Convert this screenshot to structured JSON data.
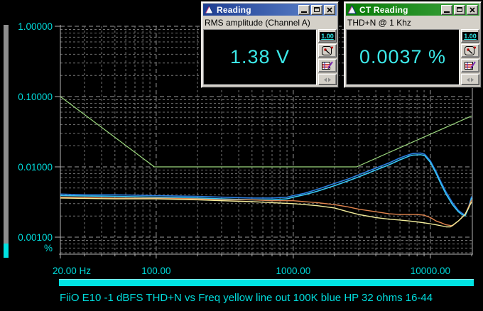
{
  "app": {
    "caption": "FiiO E10 -1 dBFS THD+N vs Freq yellow line out 100K blue HP 32 ohms 16-44"
  },
  "windows": {
    "reading": {
      "title": "Reading",
      "subtitle": "RMS amplitude (Channel A)",
      "value": "1.38 V",
      "range_button": "1.00",
      "titlebar_gradient": [
        "#1d3d92",
        "#6389cf"
      ]
    },
    "ct": {
      "title": "CT Reading",
      "subtitle": "THD+N @ 1 Khz",
      "value": "0.0037 %",
      "range_button": "1.00",
      "titlebar_gradient": [
        "#077b07",
        "#3fa33f"
      ]
    }
  },
  "colors": {
    "background": "#000000",
    "label": "#00dcdc",
    "axis": "#b2b2b2",
    "grid_major": "#9a9a9a",
    "grid_minor": "#757575",
    "scroll_track": "#8f8f8f",
    "scroll_thumb": "#00e2e2",
    "lcd_text": "#3ce9e9",
    "window_face": "#d4d0c8"
  },
  "chart_data": {
    "type": "line",
    "title": "",
    "x_axis": {
      "scale": "log",
      "min": 20,
      "max": 20000,
      "grid": true,
      "ticks": [
        {
          "value": 20,
          "label": "20.00 Hz",
          "dx": 16
        },
        {
          "value": 100,
          "label": "100.00",
          "dx": 0
        },
        {
          "value": 1000,
          "label": "1000.00",
          "dx": 0
        },
        {
          "value": 10000,
          "label": "10000.00",
          "dx": 0
        }
      ]
    },
    "y_axis": {
      "scale": "log",
      "min": 0.00056,
      "max": 1.0,
      "unit_label": "%",
      "grid": true,
      "ticks": [
        {
          "value": 1.0,
          "label": "1.00000"
        },
        {
          "value": 0.1,
          "label": "0.10000"
        },
        {
          "value": 0.01,
          "label": "0.01000"
        },
        {
          "value": 0.001,
          "label": "0.00100"
        }
      ]
    },
    "series": [
      {
        "id": "green-line-out-ref",
        "color": "#9cd87e",
        "width": 1.2,
        "points": [
          [
            20,
            0.1
          ],
          [
            97,
            0.01
          ],
          [
            2900,
            0.01
          ],
          [
            20000,
            0.053
          ]
        ]
      },
      {
        "id": "blue-hp-32ohm-a",
        "color": "#2a7de0",
        "width": 1.6,
        "points": [
          [
            20,
            0.0041
          ],
          [
            30,
            0.004
          ],
          [
            50,
            0.004
          ],
          [
            100,
            0.0039
          ],
          [
            200,
            0.0038
          ],
          [
            300,
            0.0037
          ],
          [
            500,
            0.0036
          ],
          [
            700,
            0.0036
          ],
          [
            900,
            0.0037
          ],
          [
            1000,
            0.0039
          ],
          [
            1200,
            0.0042
          ],
          [
            1500,
            0.0048
          ],
          [
            2000,
            0.0058
          ],
          [
            2500,
            0.0067
          ],
          [
            3000,
            0.0077
          ],
          [
            4000,
            0.0096
          ],
          [
            5000,
            0.0114
          ],
          [
            6000,
            0.0134
          ],
          [
            7000,
            0.015
          ],
          [
            7500,
            0.0155
          ],
          [
            8500,
            0.0157
          ],
          [
            9100,
            0.0151
          ],
          [
            10000,
            0.0122
          ],
          [
            11000,
            0.0086
          ],
          [
            12000,
            0.006
          ],
          [
            13000,
            0.0044
          ],
          [
            14500,
            0.0031
          ],
          [
            16000,
            0.0024
          ],
          [
            17000,
            0.0022
          ],
          [
            17900,
            0.00205
          ],
          [
            19000,
            0.0027
          ],
          [
            20000,
            0.0038
          ]
        ]
      },
      {
        "id": "cyan-hp-32ohm-b",
        "color": "#38c6f2",
        "width": 1.6,
        "points": [
          [
            20,
            0.0039
          ],
          [
            50,
            0.0038
          ],
          [
            100,
            0.0037
          ],
          [
            200,
            0.0036
          ],
          [
            300,
            0.0035
          ],
          [
            500,
            0.0034
          ],
          [
            700,
            0.0034
          ],
          [
            900,
            0.0035
          ],
          [
            1000,
            0.0037
          ],
          [
            1200,
            0.004
          ],
          [
            1500,
            0.0045
          ],
          [
            2000,
            0.0054
          ],
          [
            2500,
            0.0063
          ],
          [
            3000,
            0.0072
          ],
          [
            4000,
            0.009
          ],
          [
            5000,
            0.0107
          ],
          [
            6000,
            0.0126
          ],
          [
            7000,
            0.0142
          ],
          [
            7500,
            0.0147
          ],
          [
            8500,
            0.0149
          ],
          [
            9100,
            0.0144
          ],
          [
            10000,
            0.0116
          ],
          [
            11000,
            0.0081
          ],
          [
            12000,
            0.0056
          ],
          [
            13000,
            0.0041
          ],
          [
            14500,
            0.0029
          ],
          [
            16000,
            0.0023
          ],
          [
            17000,
            0.0021
          ],
          [
            17900,
            0.002
          ],
          [
            19000,
            0.0026
          ],
          [
            20000,
            0.0036
          ]
        ]
      },
      {
        "id": "orange-line-out-a",
        "color": "#e2854e",
        "width": 1.4,
        "points": [
          [
            20,
            0.0037
          ],
          [
            50,
            0.0036
          ],
          [
            100,
            0.0036
          ],
          [
            200,
            0.0035
          ],
          [
            300,
            0.0034
          ],
          [
            500,
            0.0034
          ],
          [
            700,
            0.0033
          ],
          [
            1000,
            0.0033
          ],
          [
            1500,
            0.0031
          ],
          [
            2000,
            0.0029
          ],
          [
            2500,
            0.0027
          ],
          [
            3000,
            0.0025
          ],
          [
            4000,
            0.0023
          ],
          [
            5000,
            0.00215
          ],
          [
            6000,
            0.0021
          ],
          [
            7000,
            0.0021
          ],
          [
            8000,
            0.0021
          ],
          [
            9000,
            0.00205
          ],
          [
            10000,
            0.0019
          ],
          [
            11000,
            0.0017
          ],
          [
            12000,
            0.0016
          ],
          [
            13000,
            0.0015
          ],
          [
            14500,
            0.00145
          ],
          [
            16000,
            0.0017
          ],
          [
            17000,
            0.0019
          ],
          [
            17900,
            0.0021
          ],
          [
            19000,
            0.0027
          ],
          [
            20000,
            0.0034
          ]
        ]
      },
      {
        "id": "yellow-line-out-100k",
        "color": "#f2ec9a",
        "width": 1.4,
        "points": [
          [
            20,
            0.0036
          ],
          [
            50,
            0.0035
          ],
          [
            100,
            0.0035
          ],
          [
            200,
            0.0034
          ],
          [
            300,
            0.0033
          ],
          [
            500,
            0.0032
          ],
          [
            700,
            0.0031
          ],
          [
            1000,
            0.003
          ],
          [
            1500,
            0.0028
          ],
          [
            2000,
            0.0026
          ],
          [
            2500,
            0.0023
          ],
          [
            3000,
            0.0021
          ],
          [
            4000,
            0.0019
          ],
          [
            5000,
            0.0018
          ],
          [
            6000,
            0.00175
          ],
          [
            7000,
            0.0017
          ],
          [
            8000,
            0.00165
          ],
          [
            9000,
            0.0016
          ],
          [
            10000,
            0.00155
          ],
          [
            11000,
            0.0015
          ],
          [
            12000,
            0.00145
          ],
          [
            13000,
            0.0014
          ],
          [
            14000,
            0.0014
          ],
          [
            16000,
            0.0017
          ],
          [
            17900,
            0.0021
          ],
          [
            19000,
            0.0026
          ],
          [
            20000,
            0.0032
          ]
        ]
      }
    ]
  }
}
